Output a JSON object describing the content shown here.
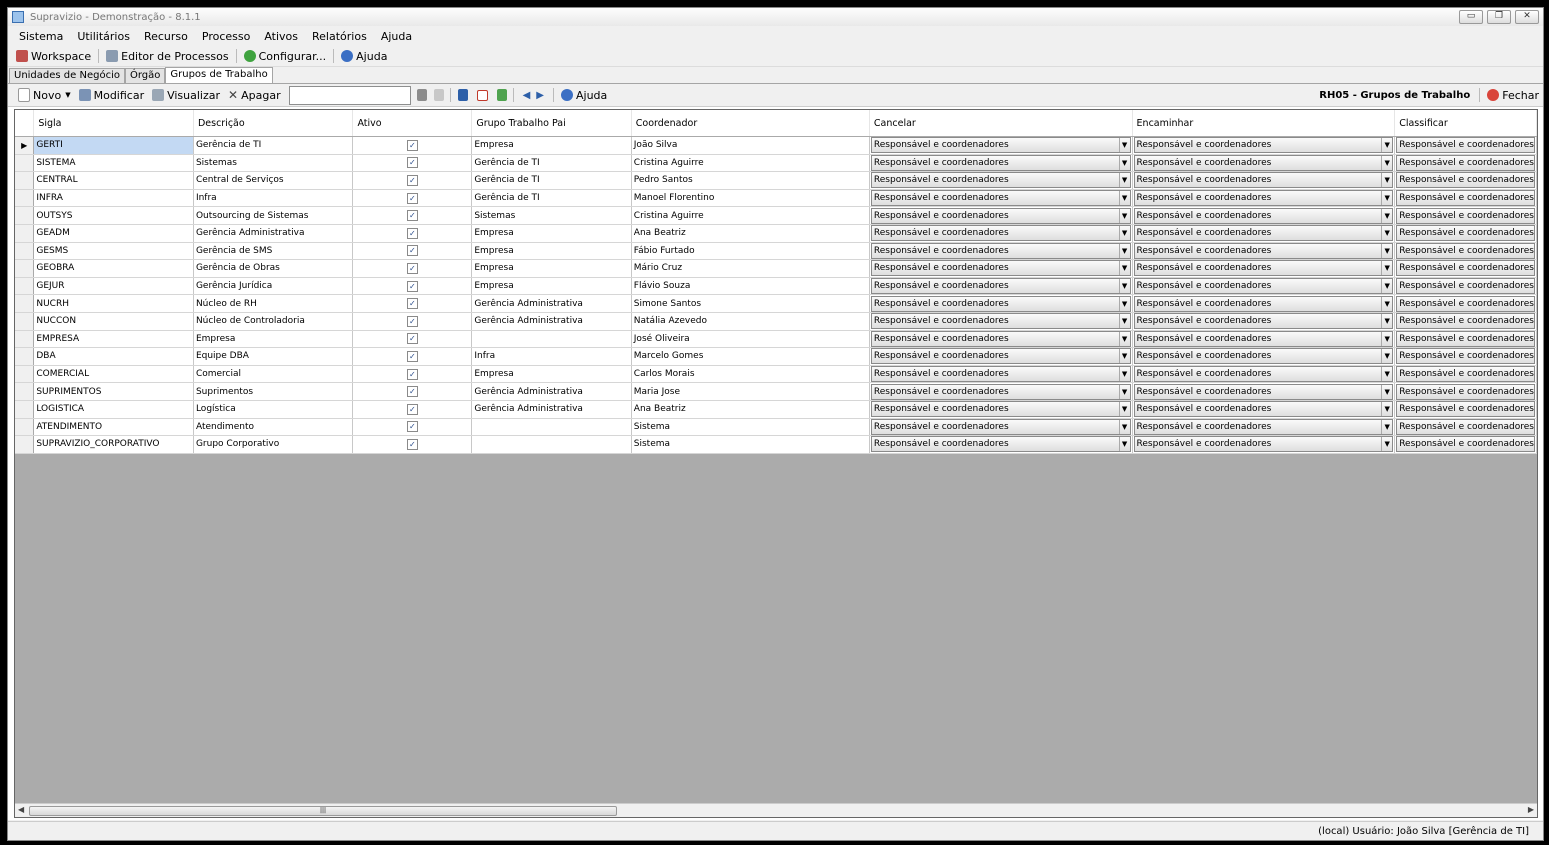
{
  "window": {
    "title": "Supravizio - Demonstração - 8.1.1",
    "minimize": "▭",
    "restore": "❐",
    "close": "✕"
  },
  "menu": [
    "Sistema",
    "Utilitários",
    "Recurso",
    "Processo",
    "Ativos",
    "Relatórios",
    "Ajuda"
  ],
  "toolbar": {
    "workspace": "Workspace",
    "editor": "Editor de Processos",
    "configurar": "Configurar...",
    "ajuda": "Ajuda"
  },
  "tabs": [
    "Unidades de Negócio",
    "Órgão",
    "Grupos de Trabalho"
  ],
  "toolbar2": {
    "novo": "Novo",
    "modificar": "Modificar",
    "visualizar": "Visualizar",
    "apagar": "Apagar",
    "filter_value": "",
    "ajuda": "Ajuda",
    "form_title": "RH05 - Grupos de Trabalho",
    "fechar": "Fechar"
  },
  "grid": {
    "columns": [
      "Sigla",
      "Descrição",
      "Ativo",
      "Grupo Trabalho Pai",
      "Coordenador",
      "Cancelar",
      "Encaminhar",
      "Classificar"
    ],
    "combo_value": "Responsável e coordenadores",
    "rows": [
      {
        "sigla": "GERTI",
        "descricao": "Gerência de TI",
        "ativo": true,
        "pai": "Empresa",
        "coordenador": "João Silva"
      },
      {
        "sigla": "SISTEMA",
        "descricao": "Sistemas",
        "ativo": true,
        "pai": "Gerência de TI",
        "coordenador": "Cristina Aguirre"
      },
      {
        "sigla": "CENTRAL",
        "descricao": "Central de Serviços",
        "ativo": true,
        "pai": "Gerência de TI",
        "coordenador": "Pedro Santos"
      },
      {
        "sigla": "INFRA",
        "descricao": "Infra",
        "ativo": true,
        "pai": "Gerência de TI",
        "coordenador": "Manoel Florentino"
      },
      {
        "sigla": "OUTSYS",
        "descricao": "Outsourcing de Sistemas",
        "ativo": true,
        "pai": "Sistemas",
        "coordenador": "Cristina Aguirre"
      },
      {
        "sigla": "GEADM",
        "descricao": "Gerência Administrativa",
        "ativo": true,
        "pai": "Empresa",
        "coordenador": "Ana Beatriz"
      },
      {
        "sigla": "GESMS",
        "descricao": "Gerência de SMS",
        "ativo": true,
        "pai": "Empresa",
        "coordenador": "Fábio Furtado"
      },
      {
        "sigla": "GEOBRA",
        "descricao": "Gerência de Obras",
        "ativo": true,
        "pai": "Empresa",
        "coordenador": "Mário Cruz"
      },
      {
        "sigla": "GEJUR",
        "descricao": "Gerência Jurídica",
        "ativo": true,
        "pai": "Empresa",
        "coordenador": "Flávio Souza"
      },
      {
        "sigla": "NUCRH",
        "descricao": "Núcleo de RH",
        "ativo": true,
        "pai": "Gerência Administrativa",
        "coordenador": "Simone Santos"
      },
      {
        "sigla": "NUCCON",
        "descricao": "Núcleo de Controladoria",
        "ativo": true,
        "pai": "Gerência Administrativa",
        "coordenador": "Natália Azevedo"
      },
      {
        "sigla": "EMPRESA",
        "descricao": "Empresa",
        "ativo": true,
        "pai": "",
        "coordenador": "José Oliveira"
      },
      {
        "sigla": "DBA",
        "descricao": "Equipe DBA",
        "ativo": true,
        "pai": "Infra",
        "coordenador": "Marcelo Gomes"
      },
      {
        "sigla": "COMERCIAL",
        "descricao": "Comercial",
        "ativo": true,
        "pai": "Empresa",
        "coordenador": "Carlos Morais"
      },
      {
        "sigla": "SUPRIMENTOS",
        "descricao": "Suprimentos",
        "ativo": true,
        "pai": "Gerência Administrativa",
        "coordenador": "Maria Jose"
      },
      {
        "sigla": "LOGISTICA",
        "descricao": "Logística",
        "ativo": true,
        "pai": "Gerência Administrativa",
        "coordenador": "Ana Beatriz"
      },
      {
        "sigla": "ATENDIMENTO",
        "descricao": "Atendimento",
        "ativo": true,
        "pai": "",
        "coordenador": "Sistema"
      },
      {
        "sigla": "SUPRAVIZIO_CORPORATIVO",
        "descricao": "Grupo Corporativo",
        "ativo": true,
        "pai": "",
        "coordenador": "Sistema"
      }
    ]
  },
  "status": {
    "text": "(local)  Usuário: João Silva [Gerência de TI]"
  },
  "colors": {
    "selection": "#c3d9f3",
    "grid_background": "#ababab"
  },
  "icons": [
    "app-icon",
    "workspace-icon",
    "editor-icon",
    "configurar-icon",
    "help-icon",
    "new-icon",
    "edit-icon",
    "view-icon",
    "delete-icon",
    "filter-icon",
    "clear-filter-icon",
    "save-icon",
    "cancel-icon",
    "refresh-icon",
    "prev-icon",
    "next-icon",
    "close-icon"
  ]
}
